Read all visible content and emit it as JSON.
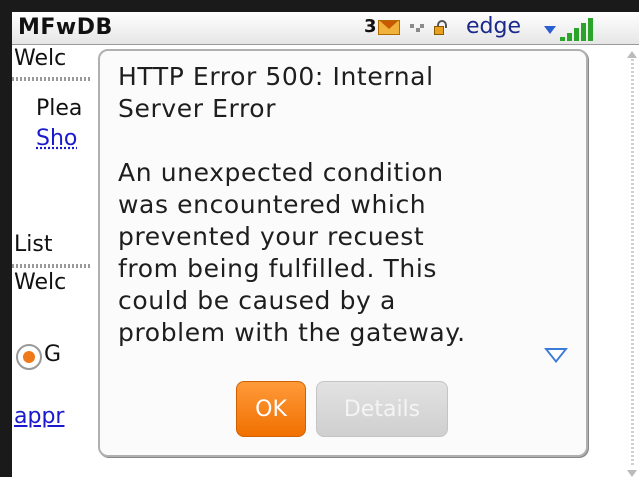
{
  "status_bar": {
    "app_title": "MFwDB",
    "message_count": "3",
    "network_label": "edge"
  },
  "background_page": {
    "welcome_line_1": "Welc",
    "please_text": "Plea",
    "show_link": "Sho",
    "list_text": "List",
    "welcome_line_2": "Welc",
    "radio_label": "G",
    "appr_link": "appr"
  },
  "dialog": {
    "title": "HTTP Error 500: Internal\nServer Error",
    "message": "An unexpected condition\nwas encountered which\nprevented your recuest\nfrom being fulfilled. This\ncould be caused by a\nproblem with the gateway.",
    "ok_label": "OK",
    "details_label": "Details"
  },
  "colors": {
    "accent": "#f07000",
    "link": "#1a1acc",
    "signal": "#2aa52a",
    "scroll_indicator": "#3a7ad8"
  },
  "icons": [
    "mail-icon",
    "lock-icon",
    "signal-bars-icon",
    "network-arrow-icon",
    "scroll-down-more-icon"
  ]
}
